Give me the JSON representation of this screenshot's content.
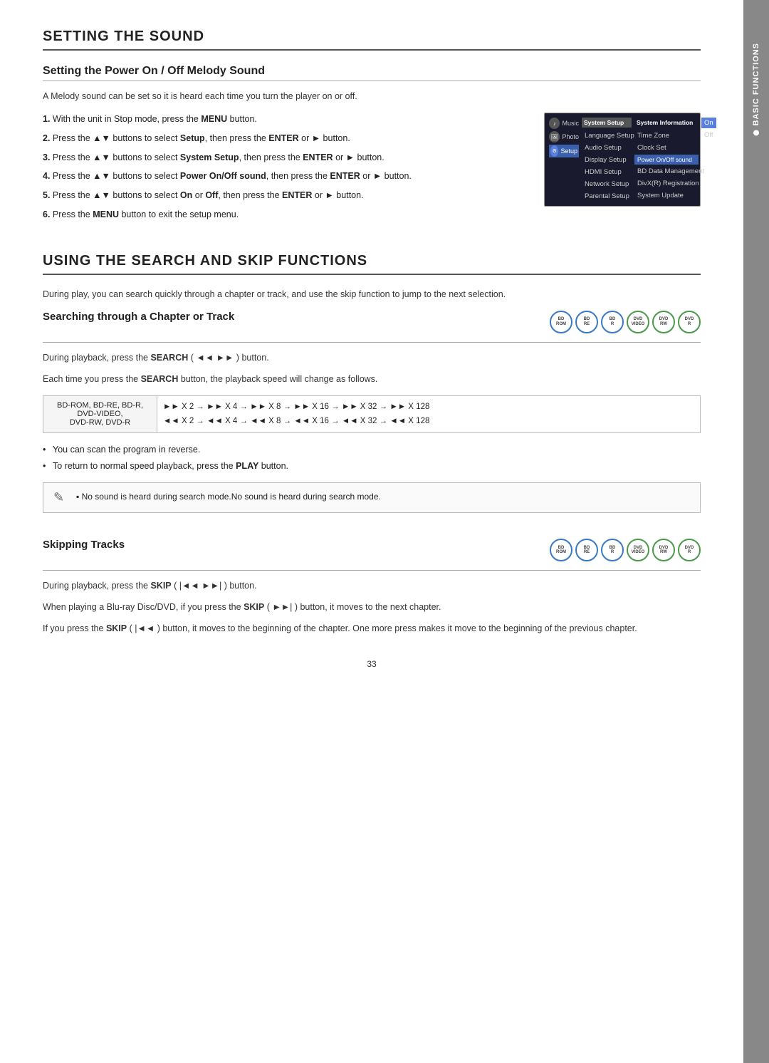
{
  "page": {
    "number": "33"
  },
  "right_tab": {
    "label": "BASIC FUNCTIONS"
  },
  "setting_sound": {
    "section_title": "SETTING THE SOUND",
    "subsection_title": "Setting the Power On / Off Melody Sound",
    "intro": "A Melody sound can be set so it is heard each time you turn the player on or off.",
    "steps": [
      {
        "number": "1.",
        "text_before": "With the unit in Stop mode, press the ",
        "bold": "MENU",
        "text_after": " button."
      },
      {
        "number": "2.",
        "text_before": "Press the ▲▼ buttons to select ",
        "bold": "Setup",
        "text_after": ", then press the ",
        "bold2": "ENTER",
        "text_after2": " or ► button."
      },
      {
        "number": "3.",
        "text_before": "Press the ▲▼ buttons to select ",
        "bold": "System Setup",
        "text_after": ", then press the ",
        "bold2": "ENTER",
        "text_after2": " or ► button."
      },
      {
        "number": "4.",
        "text_before": "Press the ▲▼ buttons to select ",
        "bold": "Power On/Off sound",
        "text_after": ", then press the ",
        "bold2": "ENTER",
        "text_after2": " or ► button."
      },
      {
        "number": "5.",
        "text_before": "Press the ▲▼ buttons to select ",
        "bold": "On",
        "text_mid": " or ",
        "bold2": "Off",
        "text_after": ", then press the ",
        "bold3": "ENTER",
        "text_after2": " or ► button."
      },
      {
        "number": "6.",
        "text_before": "Press the ",
        "bold": "MENU",
        "text_after": " button to exit the setup menu."
      }
    ],
    "menu": {
      "items_col1": [
        "Music",
        "Photo"
      ],
      "items_col2_header": "System Setup",
      "items_col2": [
        "Language Setup",
        "Audio Setup",
        "Display Setup",
        "HDMI Setup",
        "Network Setup",
        "Parental Setup"
      ],
      "items_col3_header": "System Information",
      "items_col3": [
        "Time Zone",
        "Clock Set",
        "Power On/Off sound",
        "BD Data Management",
        "DivX(R) Registration",
        "System Update"
      ],
      "items_col4": [
        "On",
        "Off"
      ]
    }
  },
  "using_search_skip": {
    "section_title": "USING THE SEARCH AND SKIP FUNCTIONS",
    "intro": "During play, you can search quickly through a chapter or track, and use the skip function to jump to the next selection.",
    "searching": {
      "subsection_title": "Searching through a Chapter or Track",
      "disc_labels": [
        "BD-ROM",
        "BD-RE",
        "BD-R",
        "DVD-VIDEO",
        "DVD-RW",
        "DVD-R"
      ],
      "desc1_before": "During playback, press the ",
      "desc1_bold": "SEARCH",
      "desc1_after": " (   ) button.",
      "desc2_before": "Each time you press the ",
      "desc2_bold": "SEARCH",
      "desc2_after": " button, the playback speed will change as follows.",
      "table": {
        "row1_label": "BD-ROM, BD-RE, BD-R, DVD-VIDEO, DVD-RW, DVD-R",
        "row1_fwd": "►► X 2 → ►► X 4 → ►► X 8 → ►► X 16 → ►► X 32 → ►► X 128",
        "row1_rev": "◄◄ X 2 → ◄◄ X 4 → ◄◄ X 8 → ◄◄ X 16 → ◄◄ X 32 → ◄◄ X 128"
      },
      "bullets": [
        "You can scan the program in reverse.",
        "To return to normal speed playback, press the PLAY button."
      ],
      "note": "No sound is heard during search mode."
    },
    "skipping": {
      "subsection_title": "Skipping Tracks",
      "disc_labels": [
        "BD-ROM",
        "BD-RE",
        "BD-R",
        "DVD-VIDEO",
        "DVD-RW",
        "DVD-R"
      ],
      "desc1_before": "During playback, press the ",
      "desc1_bold": "SKIP",
      "desc1_after": " (   ) button.",
      "desc2_before": "When playing a Blu-ray Disc/DVD, if you press the ",
      "desc2_bold": "SKIP",
      "desc2_mid": " (   ) button, it moves to the next chapter.",
      "desc3_before": "If you press the ",
      "desc3_bold": "SKIP",
      "desc3_mid": " (   ) button, it moves to the beginning of the chapter. One more press makes it move to the beginning of the previous chapter."
    }
  }
}
